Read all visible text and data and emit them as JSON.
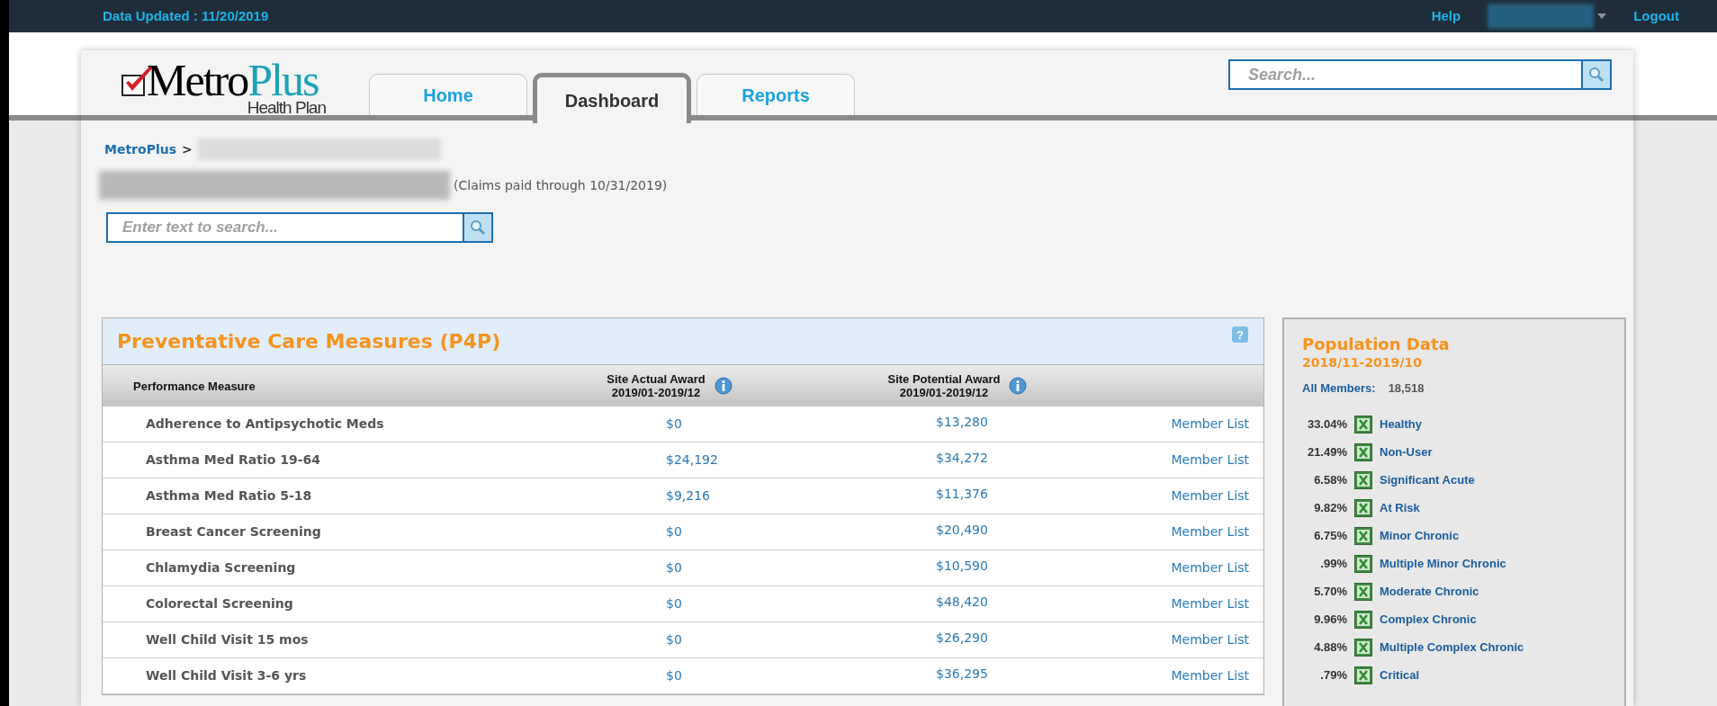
{
  "top_bar": {
    "data_updated": "Data Updated : 11/20/2019",
    "help": "Help",
    "logout": "Logout"
  },
  "logo": {
    "name_a": "Metro",
    "name_b": "Plus",
    "subtitle": "Health Plan"
  },
  "tabs": [
    {
      "label": "Home",
      "selected": false
    },
    {
      "label": "Dashboard",
      "selected": true
    },
    {
      "label": "Reports",
      "selected": false
    }
  ],
  "header_search": {
    "placeholder": "Search..."
  },
  "breadcrumb": {
    "root": "MetroPlus",
    "separator": ">"
  },
  "claims_note": "(Claims paid through 10/31/2019)",
  "page_search": {
    "placeholder": "Enter text to search..."
  },
  "measures": {
    "title": "Preventative Care Measures (P4P)",
    "help_icon": "?",
    "columns": [
      {
        "label": "Performance Measure"
      },
      {
        "label": "Site Actual Award",
        "sub": "2019/01-2019/12"
      },
      {
        "label": "Site Potential Award",
        "sub": "2019/01-2019/12"
      }
    ],
    "rows": [
      {
        "measure": "Adherence to Antipsychotic Meds",
        "actual": "$0",
        "potential": "$13,280",
        "link": "Member List"
      },
      {
        "measure": "Asthma Med Ratio 19-64",
        "actual": "$24,192",
        "potential": "$34,272",
        "link": "Member List"
      },
      {
        "measure": "Asthma Med Ratio 5-18",
        "actual": "$9,216",
        "potential": "$11,376",
        "link": "Member List"
      },
      {
        "measure": "Breast Cancer Screening",
        "actual": "$0",
        "potential": "$20,490",
        "link": "Member List"
      },
      {
        "measure": "Chlamydia Screening",
        "actual": "$0",
        "potential": "$10,590",
        "link": "Member List"
      },
      {
        "measure": "Colorectal Screening",
        "actual": "$0",
        "potential": "$48,420",
        "link": "Member List"
      },
      {
        "measure": "Well Child Visit 15 mos",
        "actual": "$0",
        "potential": "$26,290",
        "link": "Member List"
      },
      {
        "measure": "Well Child Visit 3-6 yrs",
        "actual": "$0",
        "potential": "$36,295",
        "link": "Member List"
      }
    ]
  },
  "population": {
    "title": "Population Data",
    "period": "2018/11-2019/10",
    "all_members_label": "All Members:",
    "all_members_value": "18,518",
    "groups": [
      {
        "percent": "33.04%",
        "label": "Healthy"
      },
      {
        "percent": "21.49%",
        "label": "Non-User"
      },
      {
        "percent": "6.58%",
        "label": "Significant Acute"
      },
      {
        "percent": "9.82%",
        "label": "At Risk"
      },
      {
        "percent": "6.75%",
        "label": "Minor Chronic"
      },
      {
        "percent": ".99%",
        "label": "Multiple Minor Chronic"
      },
      {
        "percent": "5.70%",
        "label": "Moderate Chronic"
      },
      {
        "percent": "9.96%",
        "label": "Complex Chronic"
      },
      {
        "percent": "4.88%",
        "label": "Multiple Complex Chronic"
      },
      {
        "percent": ".79%",
        "label": "Critical"
      }
    ]
  }
}
